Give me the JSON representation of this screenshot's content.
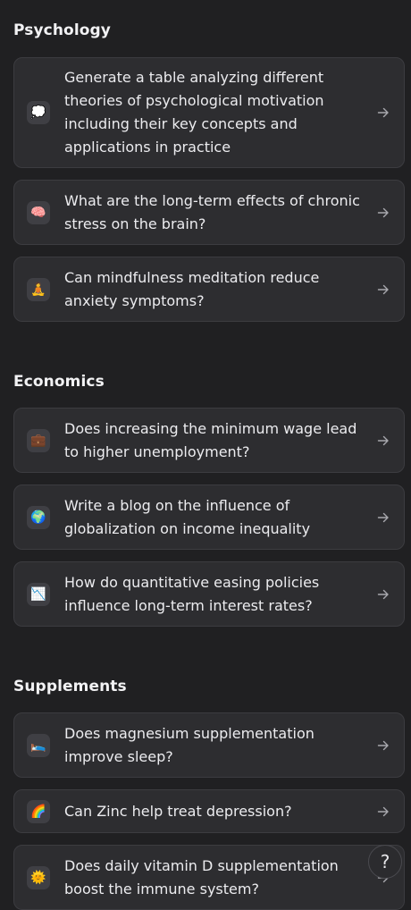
{
  "sections": [
    {
      "title": "Psychology",
      "items": [
        {
          "icon": "thought-bubble-icon",
          "glyph": "💭",
          "text": "Generate a table analyzing different theories of psychological motivation including their key concepts and applications in practice"
        },
        {
          "icon": "brain-icon",
          "glyph": "🧠",
          "text": "What are the long-term effects of chronic stress on the brain?"
        },
        {
          "icon": "meditation-icon",
          "glyph": "🧘",
          "text": "Can mindfulness meditation reduce anxiety symptoms?"
        }
      ]
    },
    {
      "title": "Economics",
      "items": [
        {
          "icon": "briefcase-icon",
          "glyph": "💼",
          "text": "Does increasing the minimum wage lead to higher unemployment?"
        },
        {
          "icon": "globe-icon",
          "glyph": "🌍",
          "text": "Write a blog on the influence of globalization on income inequality"
        },
        {
          "icon": "chart-decreasing-icon",
          "glyph": "📉",
          "text": "How do quantitative easing policies influence long-term interest rates?"
        }
      ]
    },
    {
      "title": "Supplements",
      "items": [
        {
          "icon": "bed-icon",
          "glyph": "🛌",
          "text": "Does magnesium supplementation improve sleep?"
        },
        {
          "icon": "rainbow-icon",
          "glyph": "🌈",
          "text": "Can Zinc help treat depression?"
        },
        {
          "icon": "sun-icon",
          "glyph": "🌞",
          "text": "Does daily vitamin D supplementation boost the immune system?"
        }
      ]
    }
  ],
  "help": {
    "label": "?"
  }
}
